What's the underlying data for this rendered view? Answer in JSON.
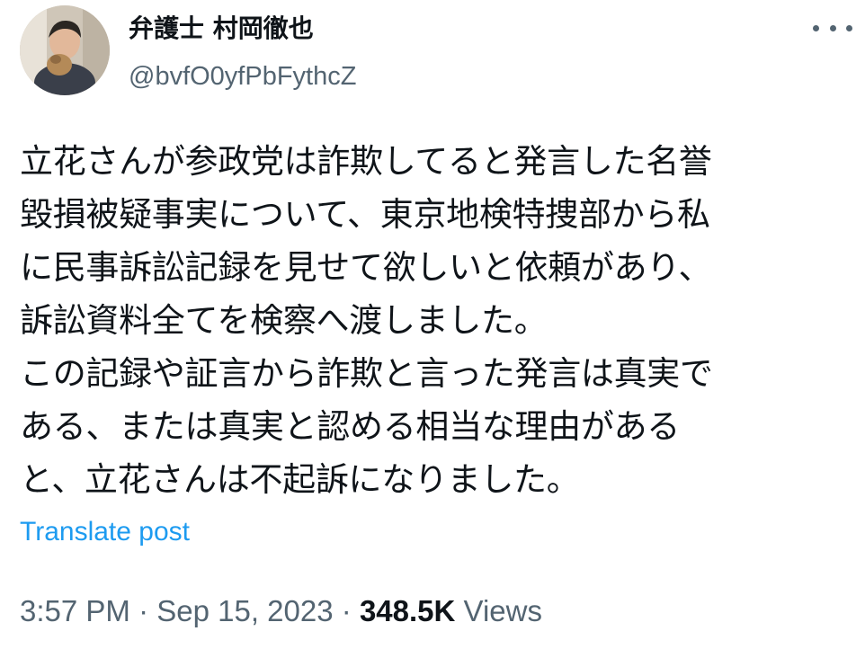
{
  "author": {
    "display_name": "弁護士 村岡徹也",
    "handle": "@bvfO0yfPbFythcZ",
    "avatar": "profile-photo"
  },
  "menu": {
    "icon": "more-horizontal-icon"
  },
  "post": {
    "text": "立花さんが参政党は詐欺してると発言した名誉\n毀損被疑事実について、東京地検特捜部から私\nに民事訴訟記録を見せて欲しいと依頼があり、\n訴訟資料全てを検察へ渡しました。\nこの記録や証言から詐欺と言った発言は真実で\nある、または真実と認める相当な理由がある\nと、立花さんは不起訴になりました。",
    "translate_label": "Translate post"
  },
  "meta": {
    "time": "3:57 PM",
    "separator": "·",
    "date": "Sep 15, 2023",
    "views_count": "348.5K",
    "views_label": "Views"
  },
  "colors": {
    "text_primary": "#0f1419",
    "text_secondary": "#536471",
    "link": "#1d9bf0"
  }
}
